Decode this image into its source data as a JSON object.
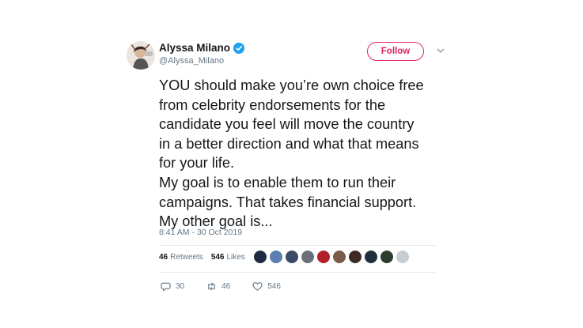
{
  "author": {
    "display_name": "Alyssa Milano",
    "handle": "@Alyssa_Milano",
    "verified": true
  },
  "follow_button": {
    "label": "Follow"
  },
  "tweet": {
    "text": "YOU should make you’re own choice free\nfrom celebrity endorsements for the\ncandidate you feel will move the country\nin a better direction and what that means\nfor your life.\nMy goal is to enable them to run their\ncampaigns. That takes financial support.\nMy other goal is...",
    "timestamp": "8:41 AM - 30 Oct 2019"
  },
  "stats": {
    "retweets_count": "46",
    "retweets_label": "Retweets",
    "likes_count": "546",
    "likes_label": "Likes"
  },
  "liker_avatar_colors": [
    "#1f2a44",
    "#5b7fb0",
    "#3b4a66",
    "#6a6f78",
    "#b3202a",
    "#7a5a4a",
    "#3e2a24",
    "#20303c",
    "#2e3e2e",
    "#c7ccd1"
  ],
  "actions": {
    "reply_count": "30",
    "retweet_count": "46",
    "like_count": "546"
  },
  "colors": {
    "verified_blue": "#1da1f2",
    "follow_accent": "#e0245e",
    "secondary_text": "#657786"
  }
}
